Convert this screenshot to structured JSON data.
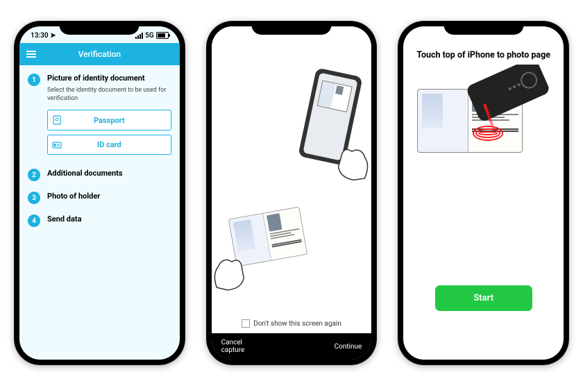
{
  "status": {
    "time": "13:30",
    "network": "5G"
  },
  "screen1": {
    "header_title": "Verification",
    "steps": [
      {
        "num": "1",
        "title": "Picture of identity document"
      },
      {
        "num": "2",
        "title": "Additional documents"
      },
      {
        "num": "3",
        "title": "Photo of holder"
      },
      {
        "num": "4",
        "title": "Send data"
      }
    ],
    "doc_select_desc": "Select the identity document to be used for verification",
    "passport_label": "Passport",
    "idcard_label": "ID card"
  },
  "screen2": {
    "dont_show_label": "Don't show this screen again",
    "cancel_label": "Cancel capture",
    "continue_label": "Continue"
  },
  "screen3": {
    "title": "Touch top of iPhone to photo page",
    "start_label": "Start"
  }
}
